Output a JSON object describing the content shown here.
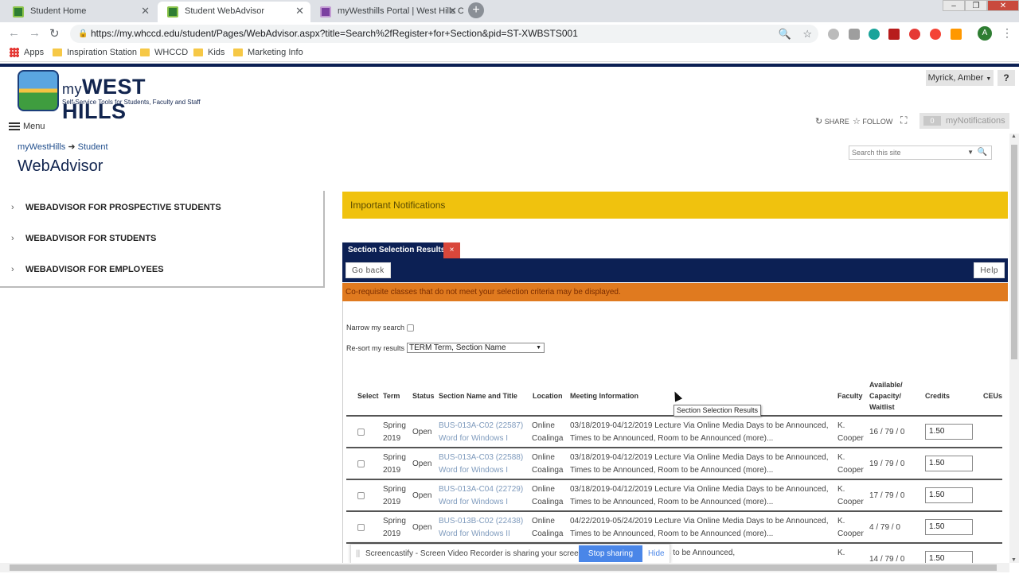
{
  "browser": {
    "tabs": [
      {
        "title": "Student Home",
        "active": false
      },
      {
        "title": "Student WebAdvisor",
        "active": true
      },
      {
        "title": "myWesthills Portal | West Hills Co",
        "active": false
      }
    ],
    "url": "https://my.whccd.edu/student/Pages/WebAdvisor.aspx?title=Search%2fRegister+for+Section&pid=ST-XWBSTS001",
    "bookmarks": [
      "Apps",
      "Inspiration Station",
      "WHCCD",
      "Kids",
      "Marketing Info"
    ],
    "profile_initial": "A"
  },
  "site": {
    "logo_prefix": "my",
    "logo_name": "WEST HILLS",
    "logo_tagline": "Self-Service Tools for Students, Faculty and Staff",
    "user_name": "Myrick, Amber",
    "help_label": "?",
    "menu_label": "Menu",
    "share_label": "SHARE",
    "follow_label": "FOLLOW",
    "notifications_count": "0",
    "notifications_label": "myNotifications",
    "breadcrumb_root": "myWestHills",
    "breadcrumb_current": "Student",
    "page_title": "WebAdvisor",
    "search_placeholder": "Search this site"
  },
  "sidebar": {
    "items": [
      {
        "label": "WEBADVISOR FOR PROSPECTIVE STUDENTS"
      },
      {
        "label": "WEBADVISOR FOR STUDENTS"
      },
      {
        "label": "WEBADVISOR FOR EMPLOYEES"
      }
    ]
  },
  "main": {
    "important_notifications": "Important Notifications",
    "section_tab": "Section Selection Results",
    "section_tab_close": "×",
    "go_back": "Go back",
    "help": "Help",
    "warning": "Co-requisite classes that do not meet your selection criteria may be displayed.",
    "narrow_label": "Narrow my search",
    "resort_label": "Re-sort my results",
    "resort_value": "TERM Term, Section Name",
    "tooltip": "Section Selection Results",
    "columns": [
      "Select",
      "Term",
      "Status",
      "Section Name and Title",
      "Location",
      "Meeting Information",
      "Faculty",
      "Available/",
      "Capacity/",
      "Waitlist",
      "Credits",
      "CEUs"
    ],
    "rows": [
      {
        "term1": "Spring",
        "term2": "2019",
        "status": "Open",
        "section": "BUS-013A-C02 (22587)",
        "title": "Word for Windows I",
        "loc1": "Online",
        "loc2": "Coalinga",
        "meet1": "03/18/2019-04/12/2019 Lecture Via Online Media Days to be Announced,",
        "meet2": "Times to be Announced, Room to be Announced (more)...",
        "fac1": "K.",
        "fac2": "Cooper",
        "avail": "16 / 79 / 0",
        "credits": "1.50"
      },
      {
        "term1": "Spring",
        "term2": "2019",
        "status": "Open",
        "section": "BUS-013A-C03 (22588)",
        "title": "Word for Windows I",
        "loc1": "Online",
        "loc2": "Coalinga",
        "meet1": "03/18/2019-04/12/2019 Lecture Via Online Media Days to be Announced,",
        "meet2": "Times to be Announced, Room to be Announced (more)...",
        "fac1": "K.",
        "fac2": "Cooper",
        "avail": "19 / 79 / 0",
        "credits": "1.50"
      },
      {
        "term1": "Spring",
        "term2": "2019",
        "status": "Open",
        "section": "BUS-013A-C04 (22729)",
        "title": "Word for Windows I",
        "loc1": "Online",
        "loc2": "Coalinga",
        "meet1": "03/18/2019-04/12/2019 Lecture Via Online Media Days to be Announced,",
        "meet2": "Times to be Announced, Room to be Announced (more)...",
        "fac1": "K.",
        "fac2": "Cooper",
        "avail": "17 / 79 / 0",
        "credits": "1.50"
      },
      {
        "term1": "Spring",
        "term2": "2019",
        "status": "Open",
        "section": "BUS-013B-C02 (22438)",
        "title": "Word for Windows II",
        "loc1": "Online",
        "loc2": "Coalinga",
        "meet1": "04/22/2019-05/24/2019 Lecture Via Online Media Days to be Announced,",
        "meet2": "Times to be Announced, Room to be Announced (more)...",
        "fac1": "K.",
        "fac2": "Cooper",
        "avail": "4 / 79 / 0",
        "credits": "1.50"
      },
      {
        "term1": "",
        "term2": "",
        "status": "",
        "section": "",
        "title": "",
        "loc1": "",
        "loc2": "",
        "meet1": "cture Via Online Media Days to be Announced,",
        "meet2": "",
        "fac1": "K.",
        "fac2": "",
        "avail": "14 / 79 / 0",
        "credits": "1.50"
      }
    ]
  },
  "share_bar": {
    "message": "Screencastify - Screen Video Recorder is sharing your screen.",
    "stop_label": "Stop sharing",
    "hide_label": "Hide"
  }
}
